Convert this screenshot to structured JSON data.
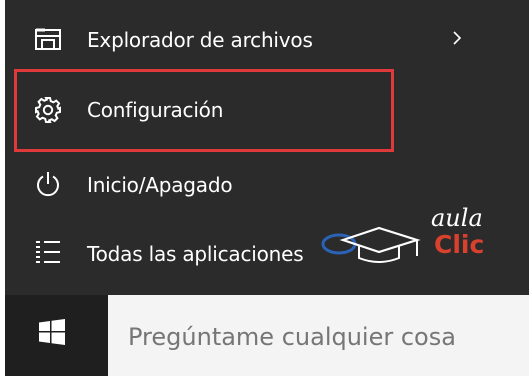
{
  "start_menu": {
    "items": [
      {
        "label": "Explorador de archivos",
        "icon": "file-explorer-icon",
        "has_submenu": true
      },
      {
        "label": "Configuración",
        "icon": "gear-icon",
        "highlighted": true
      },
      {
        "label": "Inicio/Apagado",
        "icon": "power-icon"
      },
      {
        "label": "Todas las aplicaciones",
        "icon": "all-apps-list-icon"
      }
    ],
    "highlight_color": "#e0393b"
  },
  "watermark": {
    "line1": "aula",
    "line2": "Clic",
    "accent": "#d7412d"
  },
  "taskbar": {
    "start_icon": "windows-logo-icon",
    "search_placeholder": "Pregúntame cualquier cosa"
  },
  "colors": {
    "menu_bg": "#2b2b2b",
    "text": "#ffffff",
    "search_bg": "#f4f4f4",
    "search_text": "#767676"
  }
}
